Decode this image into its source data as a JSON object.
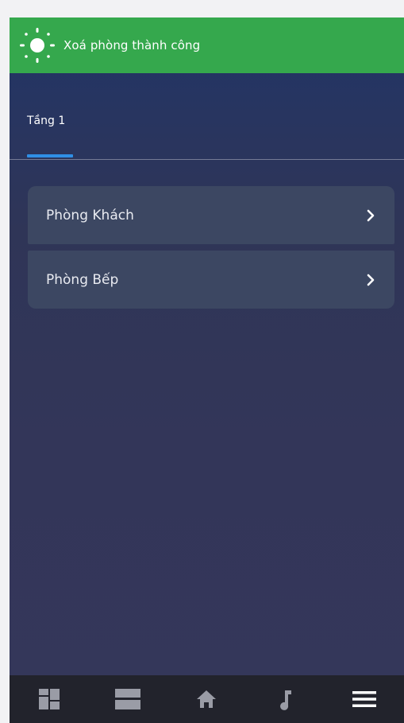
{
  "toast": {
    "message": "Xoá phòng thành công",
    "icon": "sun-icon",
    "color": "#35a84d"
  },
  "tabs": [
    {
      "label": "Tầng 1",
      "active": true
    }
  ],
  "rooms": [
    {
      "name": "Phòng Khách",
      "icon": "chevron-right-icon"
    },
    {
      "name": "Phòng Bếp",
      "icon": "chevron-right-icon"
    }
  ],
  "bottom_nav": {
    "items": [
      {
        "icon": "dashboard-icon"
      },
      {
        "icon": "rooms-icon"
      },
      {
        "icon": "home-icon"
      },
      {
        "icon": "music-icon"
      },
      {
        "icon": "menu-icon"
      }
    ]
  },
  "colors": {
    "accent": "#2f8fe6",
    "card": "#3c4762",
    "nav_bg": "#22232c"
  }
}
